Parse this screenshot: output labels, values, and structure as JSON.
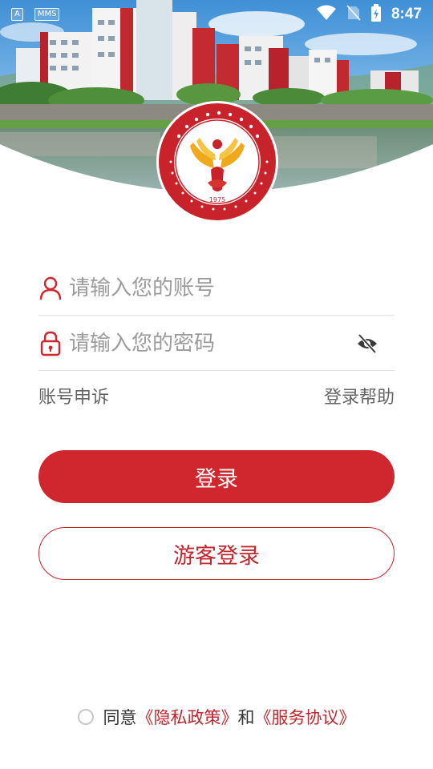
{
  "status_bar": {
    "badges": [
      "A",
      "MMS"
    ],
    "time": "8:47"
  },
  "logo": {
    "year": "1975",
    "arc_text_top": "江西水利职业技术学院",
    "arc_text_bottom": "JIANGXI WATER RESOURCES AND ELECTRIC POWER COLLEGE"
  },
  "login_form": {
    "account_placeholder": "请输入您的账号",
    "password_placeholder": "请输入您的密码"
  },
  "links": {
    "appeal": "账号申诉",
    "help": "登录帮助"
  },
  "buttons": {
    "login": "登录",
    "guest_login": "游客登录"
  },
  "agreement": {
    "prefix": "同意",
    "privacy": "《隐私政策》",
    "and": "和",
    "service": "《服务协议》"
  },
  "colors": {
    "primary": "#d0262e",
    "accent_text": "#c0262e",
    "logo_gold": "#f0a81c"
  },
  "icons": [
    "wifi-icon",
    "no-sim-icon",
    "battery-charging-icon",
    "user-icon",
    "lock-icon",
    "eye-off-icon"
  ]
}
